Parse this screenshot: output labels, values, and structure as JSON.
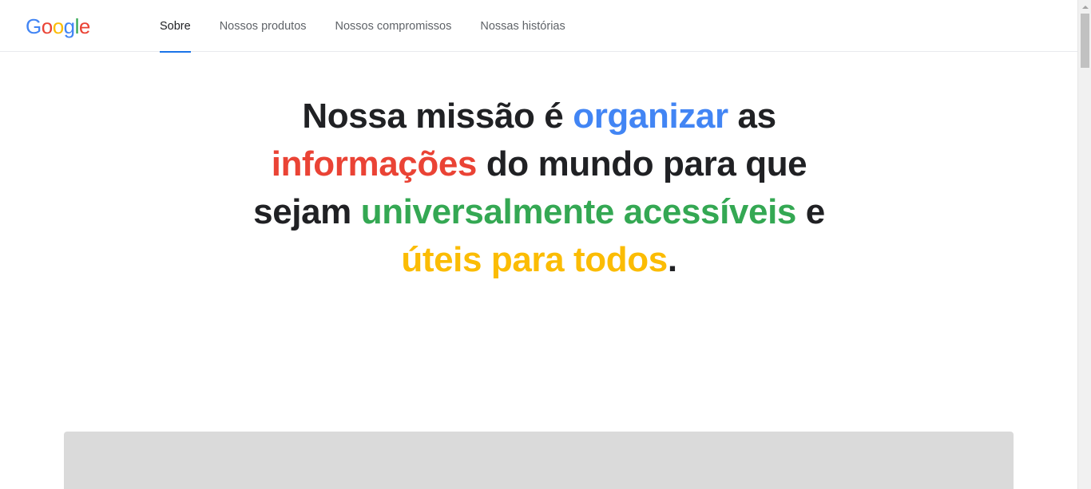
{
  "logo": {
    "letters": [
      {
        "char": "G",
        "color": "#4285f4"
      },
      {
        "char": "o",
        "color": "#ea4335"
      },
      {
        "char": "o",
        "color": "#fbbc04"
      },
      {
        "char": "g",
        "color": "#4285f4"
      },
      {
        "char": "l",
        "color": "#34a853"
      },
      {
        "char": "e",
        "color": "#ea4335"
      }
    ]
  },
  "nav": {
    "items": [
      {
        "label": "Sobre",
        "active": true
      },
      {
        "label": "Nossos produtos",
        "active": false
      },
      {
        "label": "Nossos compromissos",
        "active": false
      },
      {
        "label": "Nossas histórias",
        "active": false
      }
    ]
  },
  "mission": {
    "part1": "Nossa missão é ",
    "organize": "organizar",
    "part2": " as",
    "information": "informações",
    "part3": " do mundo para que",
    "part4": "sejam ",
    "accessible": "universalmente acessíveis",
    "part5": " e",
    "useful": "úteis para todos",
    "period": "."
  },
  "colors": {
    "accent": "#1a73e8",
    "blue": "#4285f4",
    "red": "#ea4335",
    "green": "#34a853",
    "yellow": "#fbbc04"
  }
}
